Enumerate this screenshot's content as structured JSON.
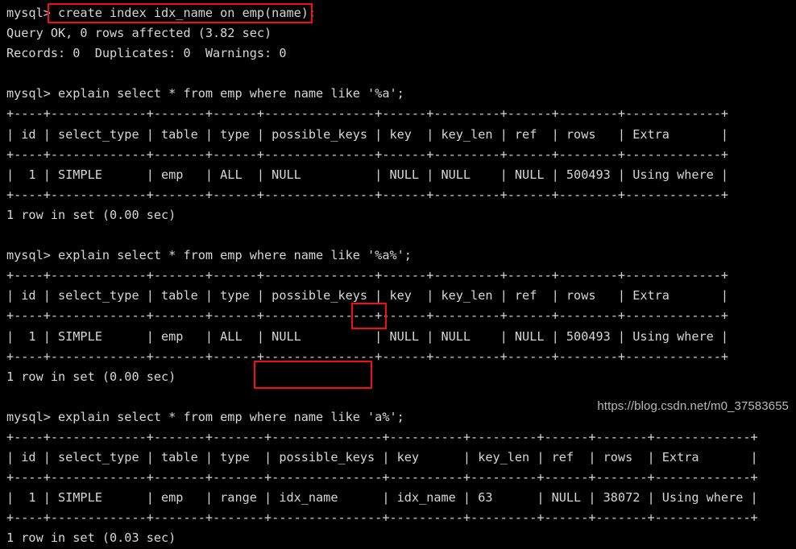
{
  "terminal": {
    "prompt": "mysql> ",
    "foreground_color": "#d6d6d6",
    "background_color": "#000000",
    "highlight_color": "#f41010",
    "lines": [
      "mysql> create index idx_name on emp(name);",
      "Query OK, 0 rows affected (3.82 sec)",
      "Records: 0  Duplicates: 0  Warnings: 0",
      "",
      "mysql> explain select * from emp where name like '%a';",
      "+----+-------------+-------+------+---------------+------+---------+------+--------+-------------+",
      "| id | select_type | table | type | possible_keys | key  | key_len | ref  | rows   | Extra       |",
      "+----+-------------+-------+------+---------------+------+---------+------+--------+-------------+",
      "|  1 | SIMPLE      | emp   | ALL  | NULL          | NULL | NULL    | NULL | 500493 | Using where |",
      "+----+-------------+-------+------+---------------+------+---------+------+--------+-------------+",
      "1 row in set (0.00 sec)",
      "",
      "mysql> explain select * from emp where name like '%a%';",
      "+----+-------------+-------+------+---------------+------+---------+------+--------+-------------+",
      "| id | select_type | table | type | possible_keys | key  | key_len | ref  | rows   | Extra       |",
      "+----+-------------+-------+------+---------------+------+---------+------+--------+-------------+",
      "|  1 | SIMPLE      | emp   | ALL  | NULL          | NULL | NULL    | NULL | 500493 | Using where |",
      "+----+-------------+-------+------+---------------+------+---------+------+--------+-------------+",
      "1 row in set (0.00 sec)",
      "",
      "mysql> explain select * from emp where name like 'a%';",
      "+----+-------------+-------+-------+---------------+----------+---------+------+-------+-------------+",
      "| id | select_type | table | type  | possible_keys | key      | key_len | ref  | rows  | Extra       |",
      "+----+-------------+-------+-------+---------------+----------+---------+------+-------+-------------+",
      "|  1 | SIMPLE      | emp   | range | idx_name      | idx_name | 63      | NULL | 38072 | Using where |",
      "+----+-------------+-------+-------+---------------+----------+---------+------+-------+-------------+",
      "1 row in set (0.03 sec)"
    ]
  },
  "commands": [
    {
      "id": "cmd-create-index",
      "statement": "create index idx_name on emp(name);",
      "result_status": "Query OK, 0 rows affected (3.82 sec)",
      "result_counts": "Records: 0  Duplicates: 0  Warnings: 0",
      "highlighted": true
    },
    {
      "id": "cmd-explain-suffix-wildcard",
      "statement": "explain select * from emp where name like '%a';",
      "footer": "1 row in set (0.00 sec)",
      "highlighted": false
    },
    {
      "id": "cmd-explain-both-wildcard",
      "statement": "explain select * from emp where name like '%a%';",
      "footer": "1 row in set (0.00 sec)",
      "highlighted": false
    },
    {
      "id": "cmd-explain-prefix-wildcard",
      "statement": "explain select * from emp where name like 'a%';",
      "footer": "1 row in set (0.03 sec)",
      "highlighted_token": "'a%';"
    }
  ],
  "explain_tables": [
    {
      "id": "explain-table-1",
      "columns": [
        "id",
        "select_type",
        "table",
        "type",
        "possible_keys",
        "key",
        "key_len",
        "ref",
        "rows",
        "Extra"
      ],
      "rows": [
        [
          "1",
          "SIMPLE",
          "emp",
          "ALL",
          "NULL",
          "NULL",
          "NULL",
          "NULL",
          "500493",
          "Using where"
        ]
      ],
      "footer": "1 row in set (0.00 sec)"
    },
    {
      "id": "explain-table-2",
      "columns": [
        "id",
        "select_type",
        "table",
        "type",
        "possible_keys",
        "key",
        "key_len",
        "ref",
        "rows",
        "Extra"
      ],
      "rows": [
        [
          "1",
          "SIMPLE",
          "emp",
          "ALL",
          "NULL",
          "NULL",
          "NULL",
          "NULL",
          "500493",
          "Using where"
        ]
      ],
      "footer": "1 row in set (0.00 sec)"
    },
    {
      "id": "explain-table-3",
      "columns": [
        "id",
        "select_type",
        "table",
        "type",
        "possible_keys",
        "key",
        "key_len",
        "ref",
        "rows",
        "Extra"
      ],
      "rows": [
        [
          "1",
          "SIMPLE",
          "emp",
          "range",
          "idx_name",
          "idx_name",
          "63",
          "NULL",
          "38072",
          "Using where"
        ]
      ],
      "footer": "1 row in set (0.03 sec)",
      "highlighted_cell": "idx_name"
    }
  ],
  "annotations": [
    {
      "id": "hl-create-index",
      "label": "create index idx_name on emp(name);"
    },
    {
      "id": "hl-like-prefix",
      "label": "'a%';"
    },
    {
      "id": "hl-possible-keys",
      "label": "idx_name"
    }
  ],
  "watermark": {
    "text": "https://blog.csdn.net/m0_37583655"
  }
}
